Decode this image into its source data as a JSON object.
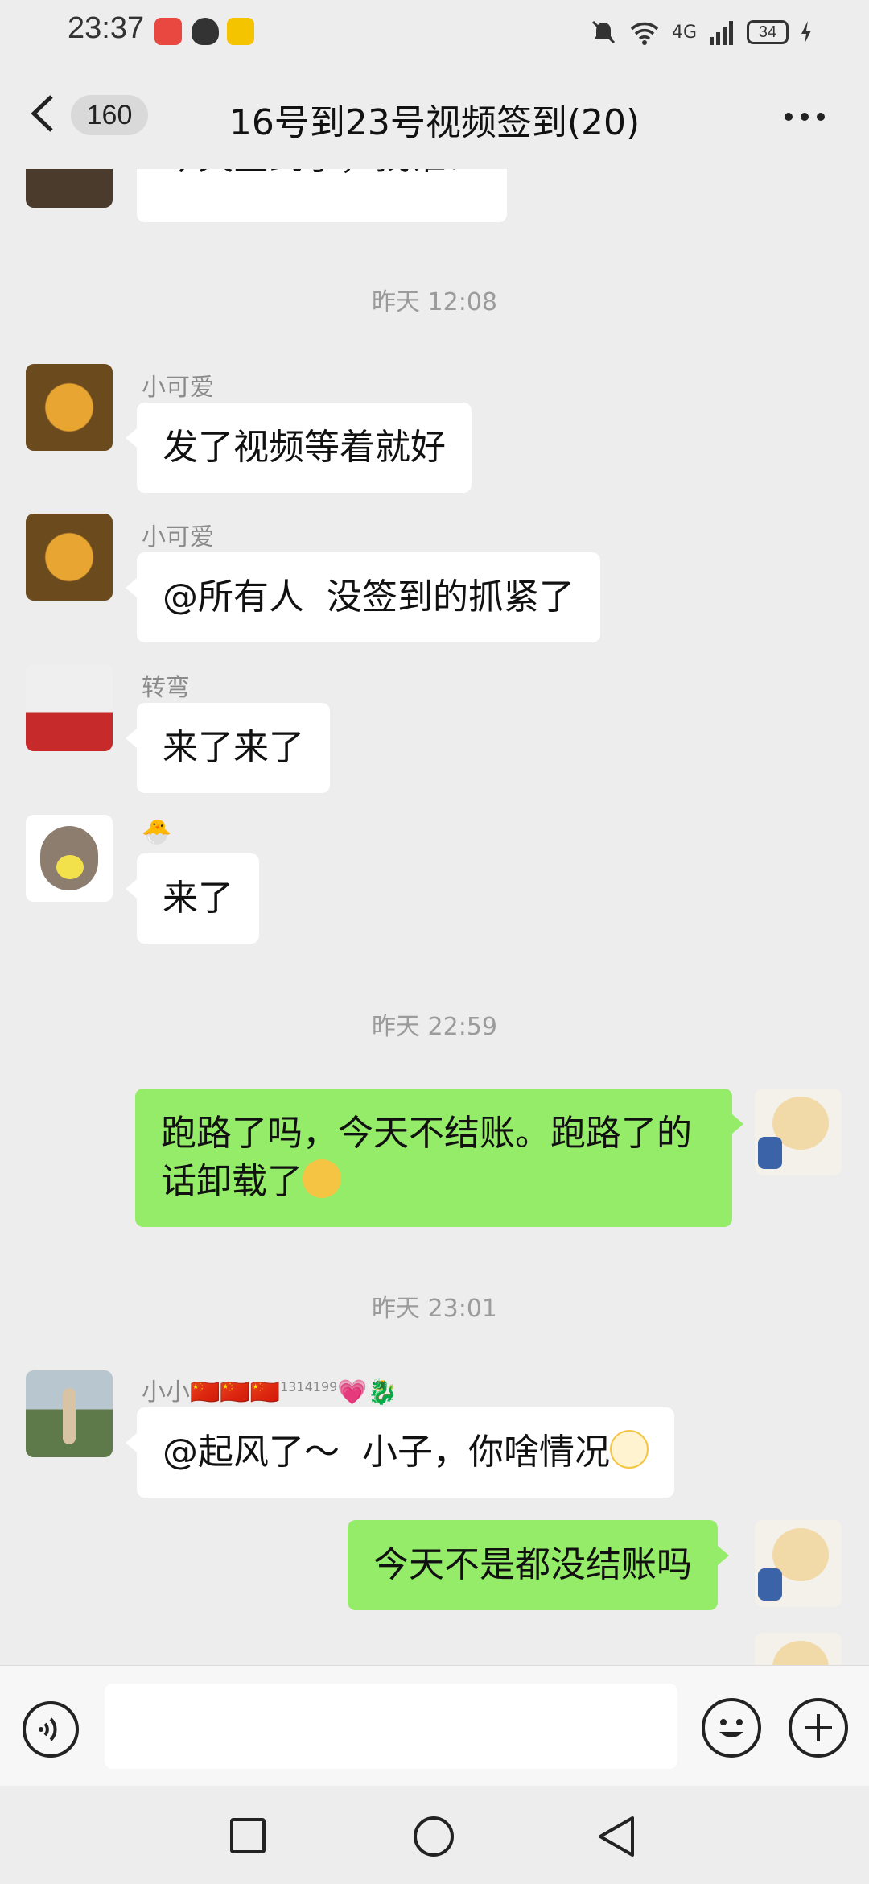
{
  "status_bar": {
    "time": "23:37",
    "network": "4G",
    "battery": "34"
  },
  "header": {
    "unread_count": "160",
    "title": "16号到23号视频签到(20)"
  },
  "messages": {
    "partial_top": {
      "text": "今天签到了，找谁？"
    },
    "ts1": "昨天 12:08",
    "m1": {
      "sender": "小可爱",
      "text": "发了视频等着就好"
    },
    "m2": {
      "sender": "小可爱",
      "text": "@所有人  没签到的抓紧了"
    },
    "m3": {
      "sender": "转弯",
      "text": "来了来了"
    },
    "m4": {
      "sender": "🐣",
      "text": "来了"
    },
    "ts2": "昨天 22:59",
    "m5": {
      "line1": "跑路了吗，今天不结账。跑路了的",
      "line2": "话卸载了"
    },
    "ts3": "昨天 23:01",
    "m6": {
      "sender_name": "小小",
      "sender_flags": "🇨🇳🇨🇳🇨🇳",
      "sender_sup": "1314199",
      "sender_tail": "💗🐉",
      "text": "@起风了～  小子，你啥情况"
    },
    "m7": {
      "text": "今天不是都没结账吗"
    }
  },
  "colors": {
    "outgoing_bubble": "#95ec69",
    "incoming_bubble": "#ffffff",
    "background": "#ededed"
  },
  "icons": [
    "back-chevron-icon",
    "more-icon",
    "voice-icon",
    "emoji-icon",
    "plus-icon",
    "recent-apps-icon",
    "home-icon",
    "system-back-icon"
  ]
}
